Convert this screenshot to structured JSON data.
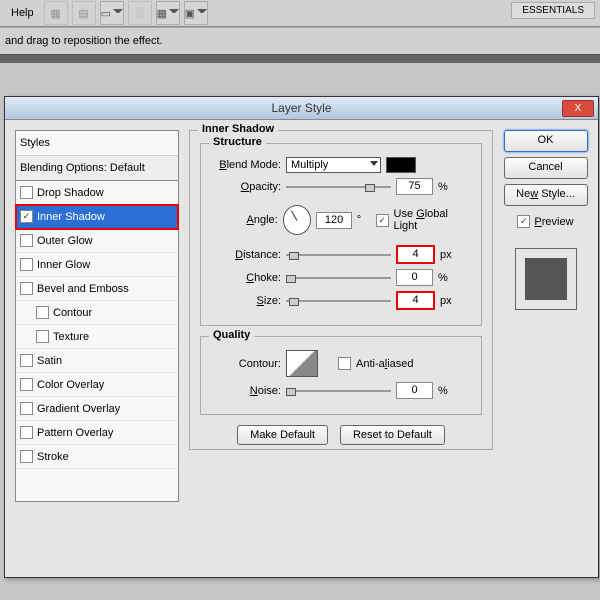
{
  "topbar": {
    "help": "Help",
    "essentials": "ESSENTIALS"
  },
  "infobar": {
    "text": "and drag to reposition the effect."
  },
  "dialog": {
    "title": "Layer Style",
    "buttons": {
      "ok": "OK",
      "cancel": "Cancel",
      "new_style": "New Style...",
      "preview": "Preview"
    }
  },
  "styles": {
    "header": "Styles",
    "blending": "Blending Options: Default",
    "items": {
      "drop_shadow": "Drop Shadow",
      "inner_shadow": "Inner Shadow",
      "outer_glow": "Outer Glow",
      "inner_glow": "Inner Glow",
      "bevel": "Bevel and Emboss",
      "contour": "Contour",
      "texture": "Texture",
      "satin": "Satin",
      "color_overlay": "Color Overlay",
      "gradient_overlay": "Gradient Overlay",
      "pattern_overlay": "Pattern Overlay",
      "stroke": "Stroke"
    }
  },
  "panel": {
    "title": "Inner Shadow",
    "structure": {
      "legend": "Structure",
      "blend_mode_label": "Blend Mode:",
      "blend_mode_value": "Multiply",
      "opacity_label": "Opacity:",
      "opacity_value": "75",
      "angle_label": "Angle:",
      "angle_value": "120",
      "global_light": "Use Global Light",
      "distance_label": "Distance:",
      "distance_value": "4",
      "choke_label": "Choke:",
      "choke_value": "0",
      "size_label": "Size:",
      "size_value": "4",
      "pct": "%",
      "px": "px",
      "deg": "°"
    },
    "quality": {
      "legend": "Quality",
      "contour_label": "Contour:",
      "anti_aliased": "Anti-aliased",
      "noise_label": "Noise:",
      "noise_value": "0",
      "pct": "%"
    },
    "defaults": {
      "make": "Make Default",
      "reset": "Reset to Default"
    }
  }
}
